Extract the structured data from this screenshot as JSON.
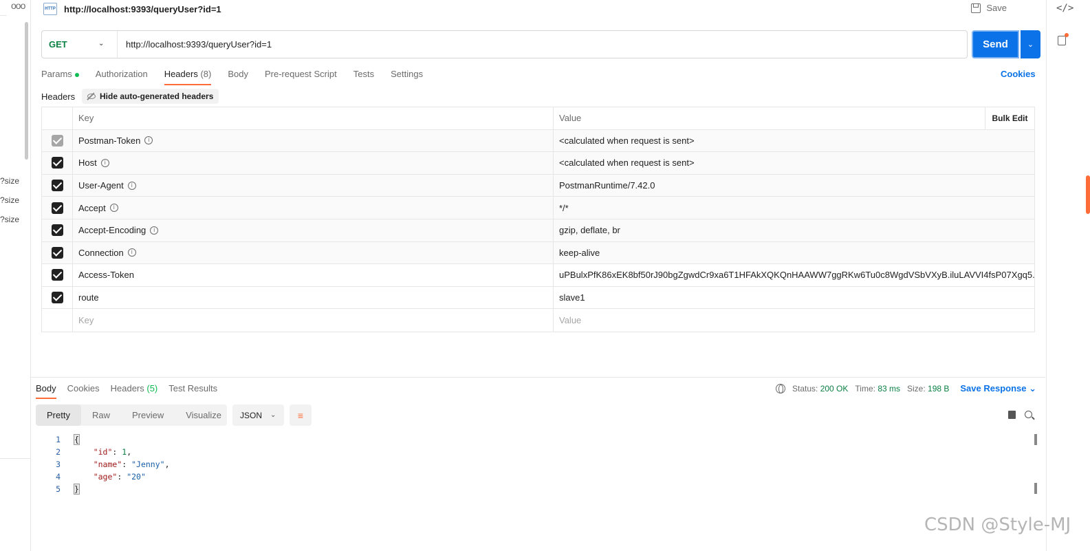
{
  "app": {
    "title": "http://localhost:9393/queryUser?id=1",
    "http_icon_label": "HTTP",
    "save_label": "Save"
  },
  "left_sidebar": {
    "truncated_items": [
      "?size",
      "?size",
      "?size"
    ]
  },
  "request": {
    "method": "GET",
    "url": "http://localhost:9393/queryUser?id=1",
    "send_label": "Send"
  },
  "request_tabs": [
    {
      "label": "Params",
      "dot": true
    },
    {
      "label": "Authorization"
    },
    {
      "label": "Headers",
      "count": "(8)",
      "active": true
    },
    {
      "label": "Body"
    },
    {
      "label": "Pre-request Script"
    },
    {
      "label": "Tests"
    },
    {
      "label": "Settings"
    }
  ],
  "cookies_label": "Cookies",
  "headers_section": {
    "label": "Headers",
    "hide_auto_label": "Hide auto-generated headers",
    "col_key": "Key",
    "col_value": "Value",
    "bulk_edit": "Bulk Edit",
    "rows": [
      {
        "key": "Postman-Token",
        "value": "<calculated when request is sent>",
        "info": true,
        "disabled": true
      },
      {
        "key": "Host",
        "value": "<calculated when request is sent>",
        "info": true
      },
      {
        "key": "User-Agent",
        "value": "PostmanRuntime/7.42.0",
        "info": true
      },
      {
        "key": "Accept",
        "value": "*/*",
        "info": true
      },
      {
        "key": "Accept-Encoding",
        "value": "gzip, deflate, br",
        "info": true
      },
      {
        "key": "Connection",
        "value": "keep-alive",
        "info": true
      },
      {
        "key": "Access-Token",
        "value": "uPBulxPfK86xEK8bf50rJ90bgZgwdCr9xa6T1HFAkXQKQnHAAWW7ggRKw6Tu0c8WgdVSbVXyB.iluLAVVI4fsP07Xgq5...",
        "info": false
      },
      {
        "key": "route",
        "value": "slave1",
        "info": false
      }
    ],
    "new_key_placeholder": "Key",
    "new_value_placeholder": "Value"
  },
  "response_tabs": [
    {
      "label": "Body",
      "active": true
    },
    {
      "label": "Cookies"
    },
    {
      "label": "Headers",
      "count": "(5)"
    },
    {
      "label": "Test Results"
    }
  ],
  "response_status": {
    "status_label": "Status:",
    "status_value": "200 OK",
    "time_label": "Time:",
    "time_value": "83 ms",
    "size_label": "Size:",
    "size_value": "198 B",
    "save_response": "Save Response"
  },
  "format_buttons": [
    "Pretty",
    "Raw",
    "Preview",
    "Visualize"
  ],
  "language": "JSON",
  "code_lines": [
    {
      "num": "1"
    },
    {
      "num": "2",
      "key": "\"id\"",
      "val": "1",
      "type": "n"
    },
    {
      "num": "3",
      "key": "\"name\"",
      "val": "\"Jenny\"",
      "type": "s"
    },
    {
      "num": "4",
      "key": "\"age\"",
      "val": "\"20\"",
      "type": "s"
    },
    {
      "num": "5"
    }
  ],
  "watermark": "CSDN @Style-MJ",
  "colors": {
    "accent": "#ff6c37",
    "primary": "#0b72e7",
    "get_method": "#0b8043"
  }
}
